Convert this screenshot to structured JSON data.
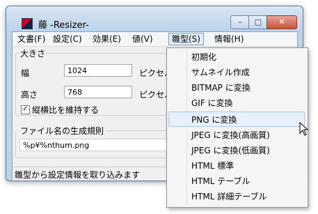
{
  "window": {
    "title": "藤 -Resizer-",
    "minimize_glyph": "–",
    "maximize_glyph": "□",
    "close_glyph": "✕"
  },
  "menubar": [
    {
      "label": "文書(F)"
    },
    {
      "label": "設定(C)"
    },
    {
      "label": "効果(E)"
    },
    {
      "label": "値(V)"
    },
    {
      "label": "雛型(S)"
    },
    {
      "label": "情報(H)"
    }
  ],
  "size_group": {
    "label": "大きさ",
    "width_label": "幅",
    "width_value": "1024",
    "width_unit": "ピクセル",
    "height_label": "高さ",
    "height_value": "768",
    "height_unit": "ピクセル",
    "keep_ratio_label": "縦横比を維持する",
    "keep_ratio_checked": true,
    "check_glyph": "✓"
  },
  "filename_group": {
    "label": "ファイル名の生成規則",
    "value": "%p¥%nthum.png"
  },
  "status": "雛型から設定情報を取り込みます",
  "template_menu": {
    "items": [
      {
        "label": "初期化"
      },
      {
        "label": "サムネイル作成"
      },
      {
        "label": "BITMAP に変換"
      },
      {
        "label": "GIF に変換"
      },
      {
        "label": "PNG に変換"
      },
      {
        "label": "JPEG に変換(高画質)"
      },
      {
        "label": "JPEG に変換(低画質)"
      },
      {
        "label": "HTML 標準"
      },
      {
        "label": "HTML テーブル"
      },
      {
        "label": "HTML 詳細テーブル"
      }
    ],
    "highlighted_item": "PNG に変換"
  },
  "colors": {
    "highlight": "#e8f1fb",
    "active_menu_border": "#7a9bc2"
  }
}
